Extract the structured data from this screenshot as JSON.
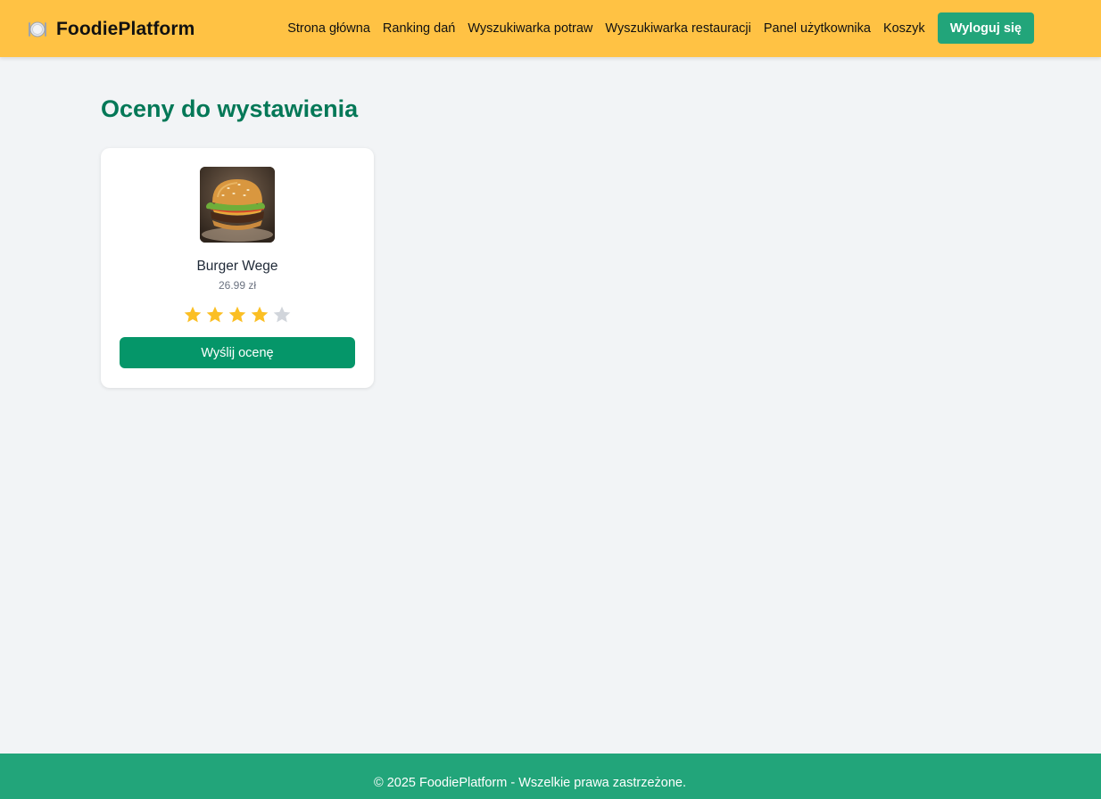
{
  "brand": {
    "name": "FoodiePlatform",
    "icon": "plate-icon"
  },
  "nav": {
    "links": [
      {
        "label": "Strona główna"
      },
      {
        "label": "Ranking dań"
      },
      {
        "label": "Wyszukiwarka potraw"
      },
      {
        "label": "Wyszukiwarka restauracji"
      },
      {
        "label": "Panel użytkownika"
      },
      {
        "label": "Koszyk"
      }
    ],
    "logout_label": "Wyloguj się"
  },
  "main": {
    "title": "Oceny do wystawienia",
    "cards": [
      {
        "name": "Burger Wege",
        "price": "26.99 zł",
        "image_icon": "burger-image",
        "rating": 4,
        "max_rating": 5,
        "submit_label": "Wyślij ocenę"
      }
    ]
  },
  "footer": {
    "text": "© 2025 FoodiePlatform - Wszelkie prawa zastrzeżone."
  },
  "colors": {
    "header_bg": "#ffc244",
    "accent_green": "#22a57a",
    "button_green": "#059669",
    "title_green": "#047857",
    "star_filled": "#fbbf24",
    "star_empty": "#d1d5db",
    "page_bg": "#f2f4f6"
  }
}
